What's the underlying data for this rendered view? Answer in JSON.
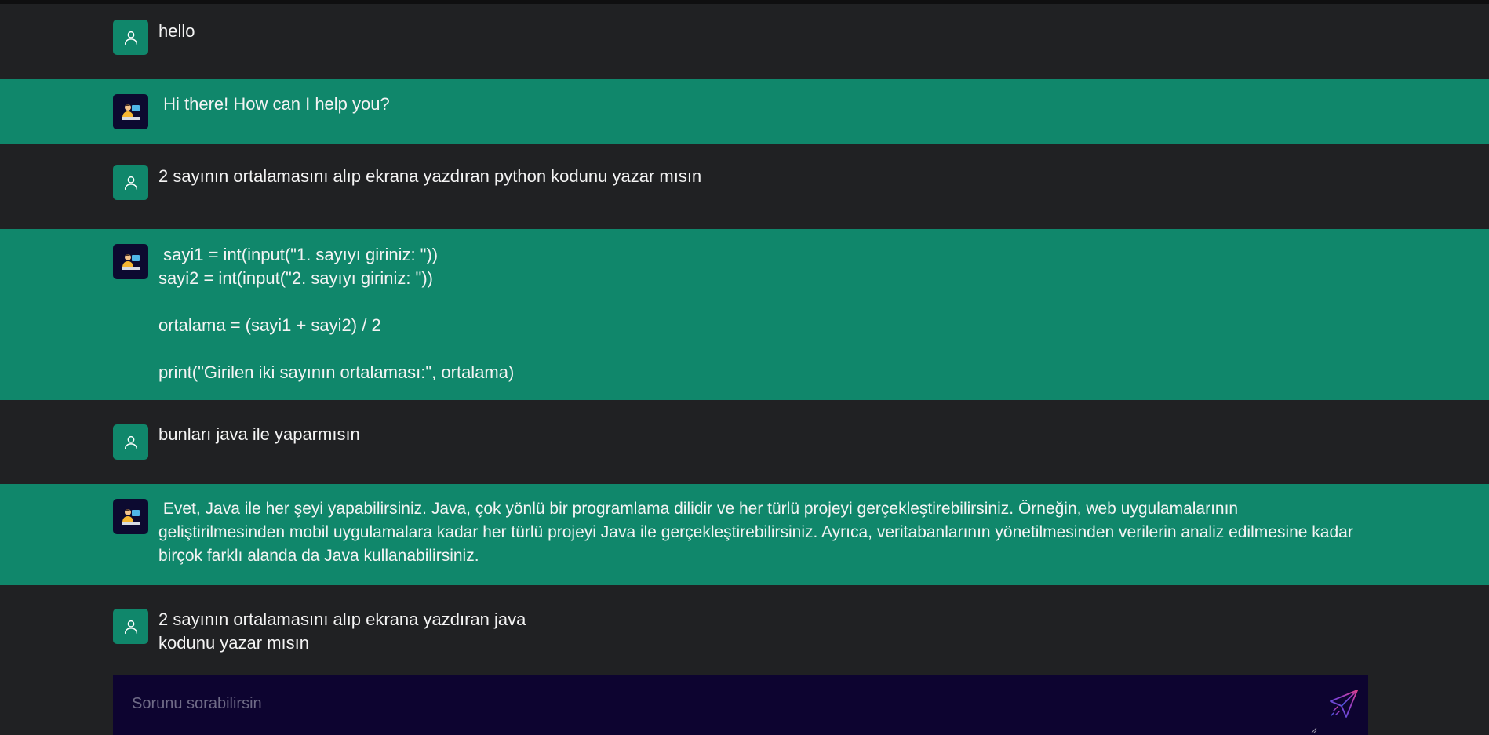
{
  "messages": [
    {
      "role": "user",
      "avatar_icon": "user-icon",
      "text": "hello"
    },
    {
      "role": "bot",
      "avatar_icon": "bot-avatar-icon",
      "text": " Hi there! How can I help you?"
    },
    {
      "role": "user",
      "avatar_icon": "user-icon",
      "text": "2 sayının ortalamasını alıp ekrana yazdıran python kodunu yazar mısın"
    },
    {
      "role": "bot",
      "avatar_icon": "bot-avatar-icon",
      "text": " sayi1 = int(input(\"1. sayıyı giriniz: \"))\nsayi2 = int(input(\"2. sayıyı giriniz: \"))\n\nortalama = (sayi1 + sayi2) / 2\n\nprint(\"Girilen iki sayının ortalaması:\", ortalama)"
    },
    {
      "role": "user",
      "avatar_icon": "user-icon",
      "text": "bunları java ile yaparmısın"
    },
    {
      "role": "bot",
      "avatar_icon": "bot-avatar-icon",
      "text": " Evet, Java ile her şeyi yapabilirsiniz. Java, çok yönlü bir programlama dilidir ve her türlü projeyi gerçekleştirebilirsiniz. Örneğin, web uygulamalarının geliştirilmesinden mobil uygulamalara kadar her türlü projeyi Java ile gerçekleştirebilirsiniz. Ayrıca, veritabanlarının yönetilmesinden verilerin analiz edilmesine kadar birçok farklı alanda da Java kullanabilirsiniz."
    },
    {
      "role": "user",
      "avatar_icon": "user-icon",
      "text": "2 sayının ortalamasını alıp ekrana yazdıran java\nkodunu yazar mısın"
    }
  ],
  "composer": {
    "placeholder": "Sorunu sorabilirsin",
    "value": "",
    "send_icon": "send-icon"
  },
  "colors": {
    "user_bg": "#202123",
    "bot_bg": "#10876b",
    "user_avatar_bg": "#10876b",
    "bot_avatar_bg": "#0c0a30",
    "composer_bg": "#0d0430"
  }
}
